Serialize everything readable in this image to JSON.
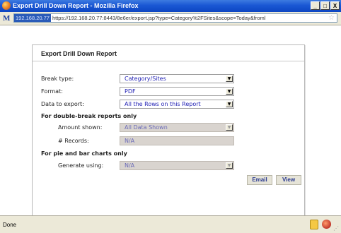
{
  "window": {
    "title": "Export Drill Down Report - Mozilla Firefox",
    "buttons": {
      "minimize": "_",
      "maximize": "□",
      "close": "X"
    }
  },
  "urlbar": {
    "host": "192.168.20.77",
    "url": "https://192.168.20.77:8443/8e6er/export.jsp?type=Category%2FSites&scope=Today&froml"
  },
  "dialog": {
    "title": "Export Drill Down Report",
    "break_type_label": "Break type:",
    "break_type_value": "Category/Sites",
    "format_label": "Format:",
    "format_value": "PDF",
    "data_label": "Data to export:",
    "data_value": "All the Rows on this Report",
    "double_break_heading": "For double-break reports only",
    "amount_label": "Amount shown:",
    "amount_value": "All Data Shown",
    "records_label": "# Records:",
    "records_value": "N/A",
    "pie_heading": "For pie and bar charts only",
    "generate_label": "Generate using:",
    "generate_value": "N/A",
    "email_button": "Email",
    "view_button": "View"
  },
  "status": {
    "text": "Done"
  },
  "icons": {
    "app": "firefox-icon",
    "site": "m-site-icon",
    "bookmark": "star-icon",
    "dropdown": "chevron-down-icon",
    "security": "lock-icon",
    "addon": "addon-icon"
  }
}
